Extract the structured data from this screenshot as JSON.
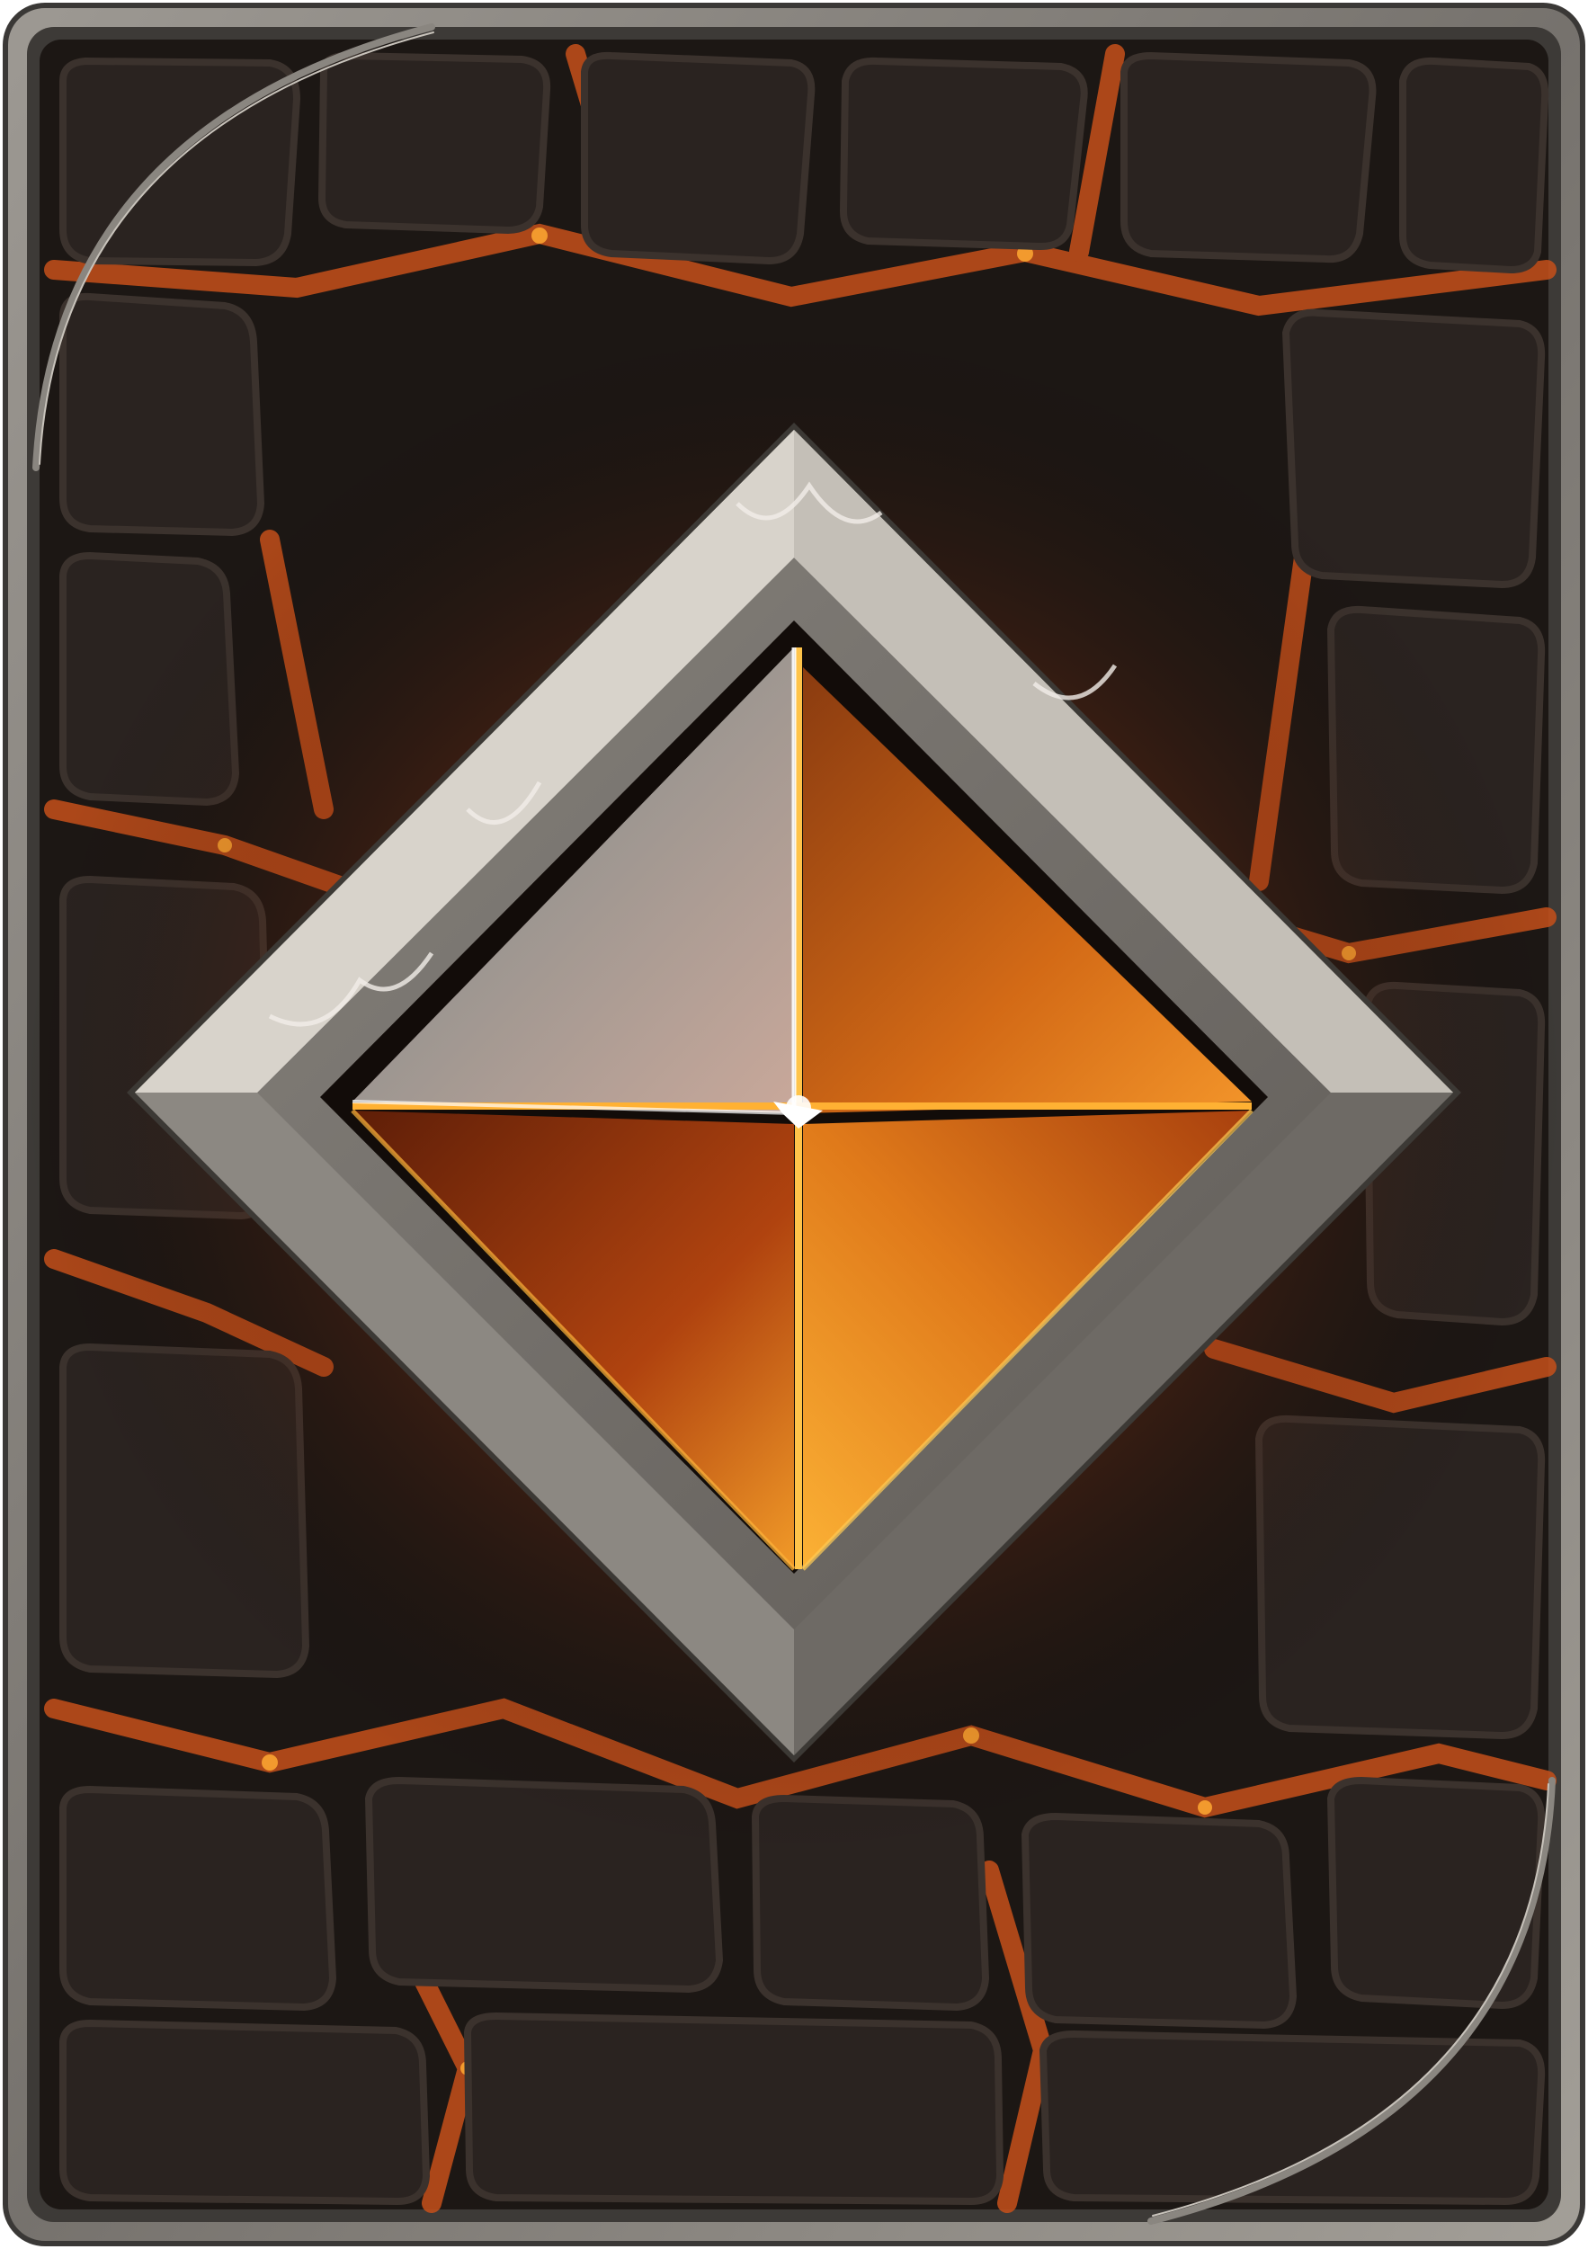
{
  "card": {
    "kind": "card-back",
    "emblem": "diamond-gem-icon",
    "background": "cobblestone-lava-pattern",
    "colors": {
      "frame": "#8a8680",
      "frame_dark": "#4a4744",
      "inner_bg": "#1a1512",
      "stone": "#2a2320",
      "stone_edge": "#3b322d",
      "lava": "#d0561a",
      "lava_bright": "#f29a2e",
      "gem_silver_light": "#d9d3cc",
      "gem_silver_dark": "#5c5a58",
      "gem_orange_light": "#f7a224",
      "gem_orange_dark": "#7a2a0e",
      "bezel_light": "#d8d3cb",
      "bezel_dark": "#5b5753"
    }
  }
}
